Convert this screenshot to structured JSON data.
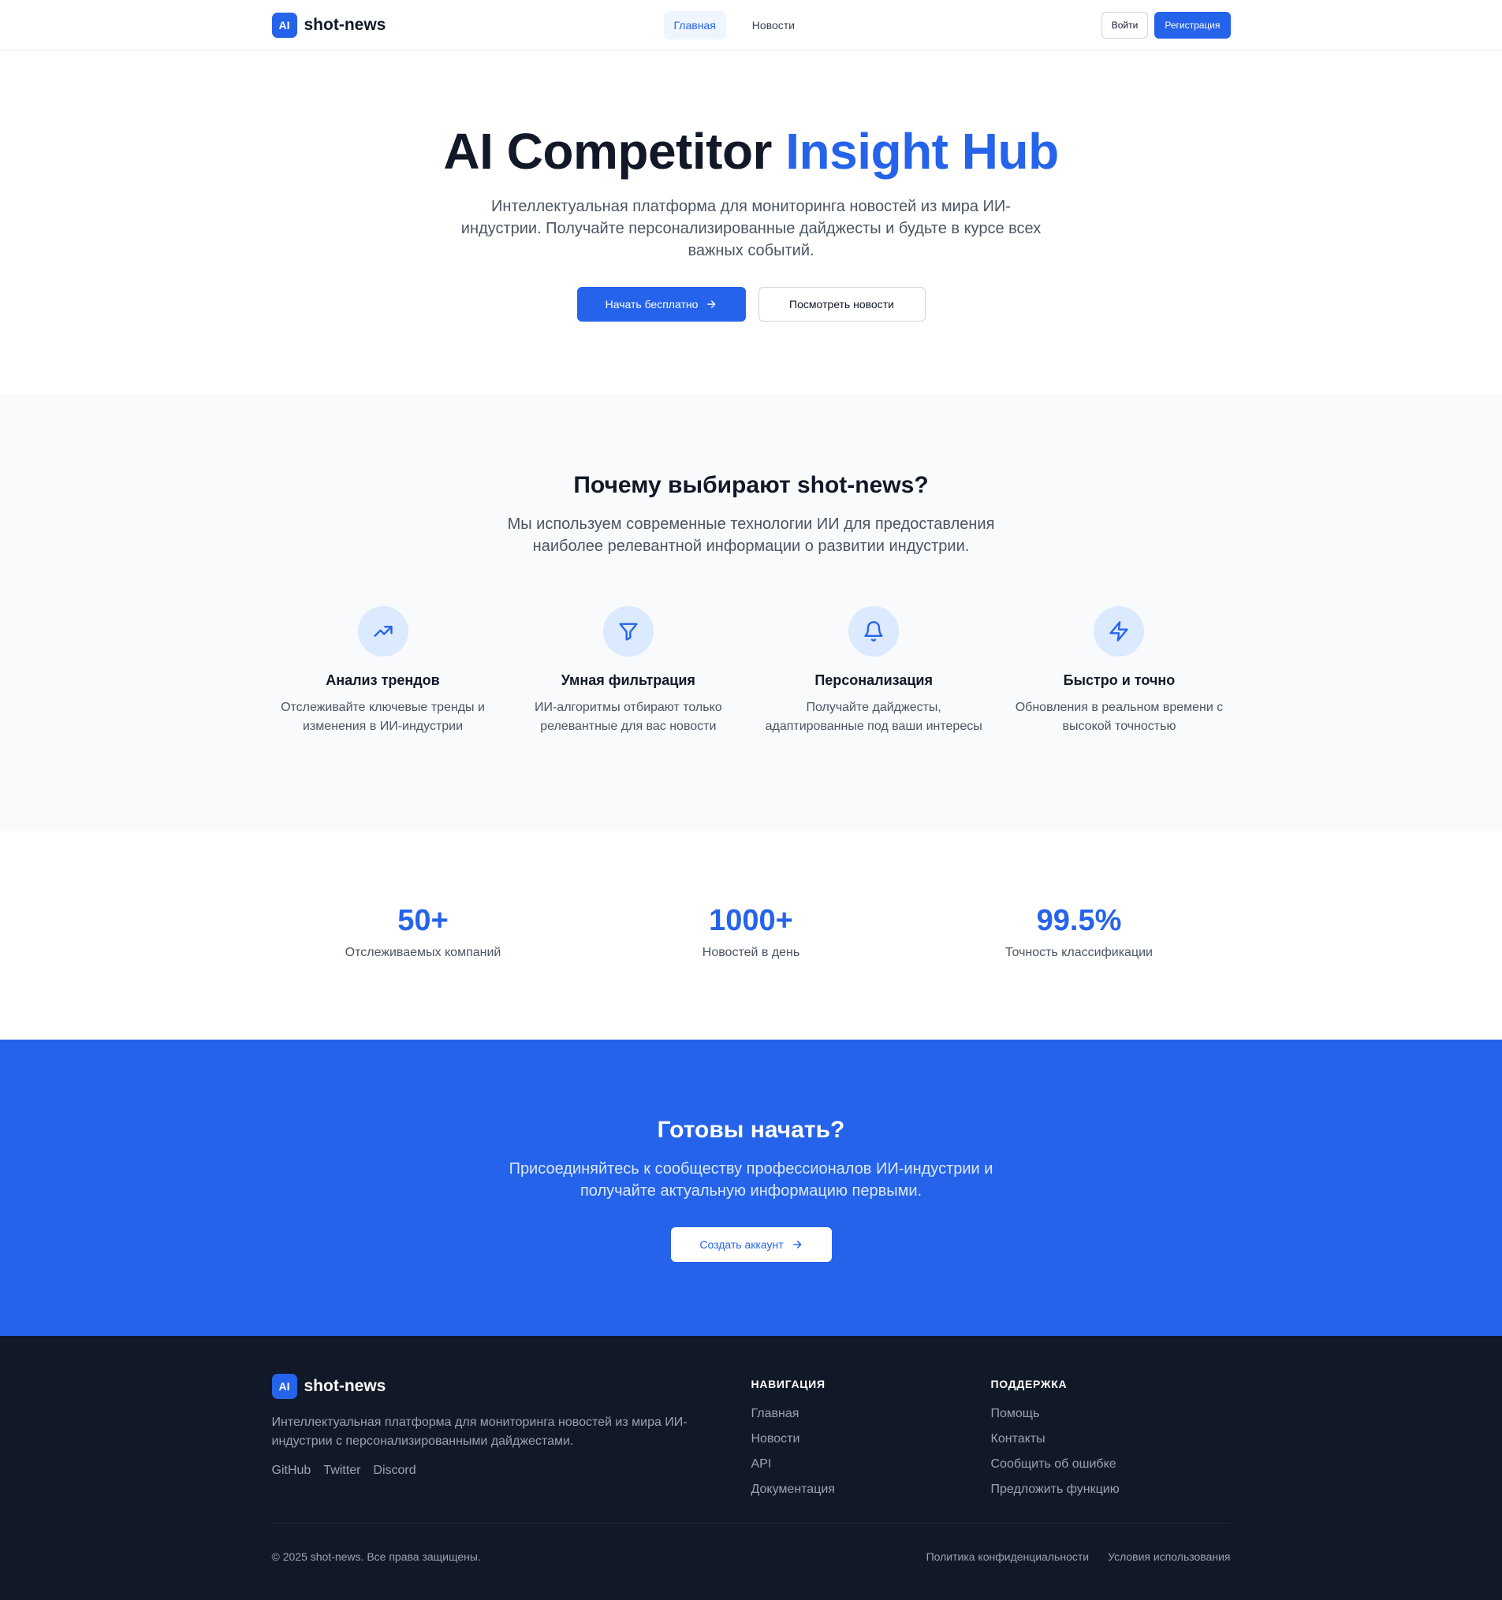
{
  "brand": {
    "badge": "AI",
    "name": "shot-news"
  },
  "nav": {
    "items": [
      {
        "label": "Главная",
        "active": true
      },
      {
        "label": "Новости",
        "active": false
      }
    ],
    "login": "Войти",
    "register": "Регистрация"
  },
  "hero": {
    "title_main": "AI Competitor",
    "title_accent": "Insight Hub",
    "description": "Интеллектуальная платформа для мониторинга новостей из мира ИИ-индустрии. Получайте персонализированные дайджесты и будьте в курсе всех важных событий.",
    "primary_button": "Начать бесплатно",
    "secondary_button": "Посмотреть новости"
  },
  "features": {
    "title": "Почему выбирают shot-news?",
    "subtitle": "Мы используем современные технологии ИИ для предоставления наиболее релевантной информации о развитии индустрии.",
    "items": [
      {
        "icon": "trending-up-icon",
        "title": "Анализ трендов",
        "text": "Отслеживайте ключевые тренды и изменения в ИИ-индустрии"
      },
      {
        "icon": "filter-icon",
        "title": "Умная фильтрация",
        "text": "ИИ-алгоритмы отбирают только релевантные для вас новости"
      },
      {
        "icon": "bell-icon",
        "title": "Персонализация",
        "text": "Получайте дайджесты, адаптированные под ваши интересы"
      },
      {
        "icon": "lightning-icon",
        "title": "Быстро и точно",
        "text": "Обновления в реальном времени с высокой точностью"
      }
    ]
  },
  "stats": [
    {
      "value": "50+",
      "label": "Отслеживаемых компаний"
    },
    {
      "value": "1000+",
      "label": "Новостей в день"
    },
    {
      "value": "99.5%",
      "label": "Точность классификации"
    }
  ],
  "cta": {
    "title": "Готовы начать?",
    "text": "Присоединяйтесь к сообществу профессионалов ИИ-индустрии и получайте актуальную информацию первыми.",
    "button": "Создать аккаунт"
  },
  "footer": {
    "description": "Интеллектуальная платформа для мониторинга новостей из мира ИИ-индустрии с персонализированными дайджестами.",
    "socials": [
      "GitHub",
      "Twitter",
      "Discord"
    ],
    "nav_title": "Навигация",
    "nav_links": [
      "Главная",
      "Новости",
      "API",
      "Документация"
    ],
    "support_title": "Поддержка",
    "support_links": [
      "Помощь",
      "Контакты",
      "Сообщить об ошибке",
      "Предложить функцию"
    ],
    "copyright": "© 2025 shot-news. Все права защищены.",
    "legal": [
      "Политика конфиденциальности",
      "Условия использования"
    ]
  },
  "colors": {
    "accent": "#2563eb",
    "dark": "#111827",
    "muted": "#4b5563",
    "section_bg": "#f8fafc"
  }
}
